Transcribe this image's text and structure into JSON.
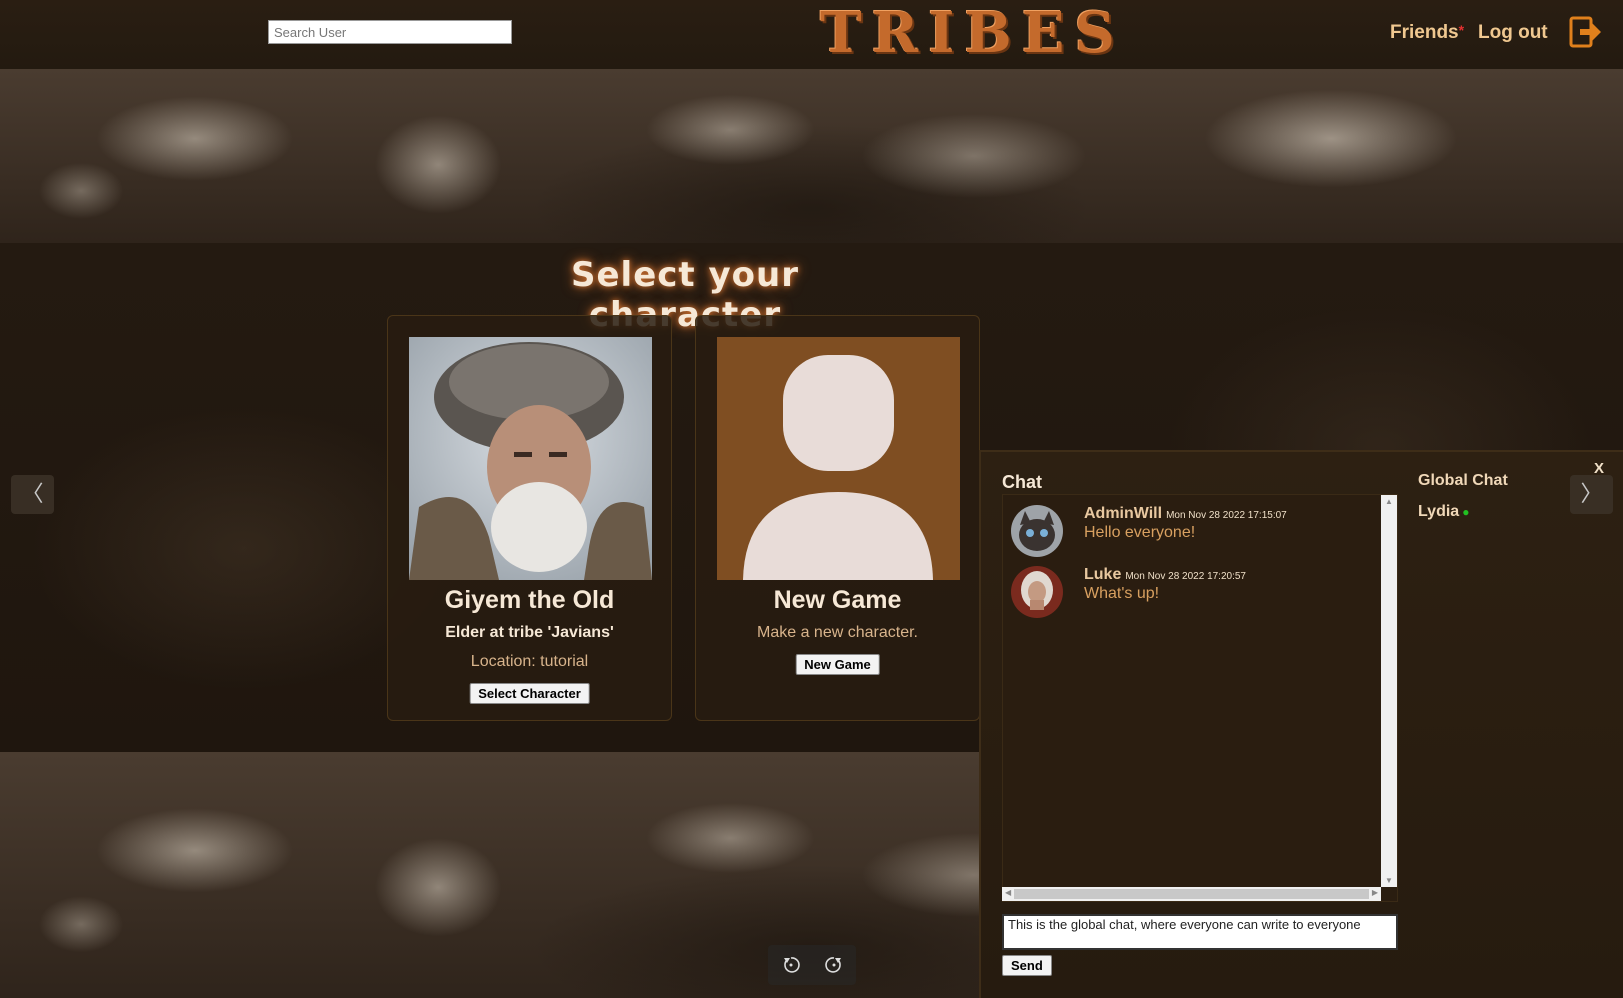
{
  "header": {
    "search_placeholder": "Search User",
    "logo": "TRIBES",
    "friends_label": "Friends",
    "friends_indicator": "*",
    "logout_label": "Log out"
  },
  "main": {
    "title": "Select your character",
    "characters": [
      {
        "name": "Giyem the Old",
        "role": "Elder at tribe 'Javians'",
        "location": "Location: tutorial",
        "button": "Select Character"
      },
      {
        "name": "New Game",
        "description": "Make a new character.",
        "button": "New Game"
      }
    ],
    "prev_arrow": "〈",
    "next_arrow": "〉"
  },
  "chat": {
    "title": "Chat",
    "close_label": "X",
    "messages": [
      {
        "author": "AdminWill",
        "timestamp": "Mon Nov 28 2022 17:15:07",
        "text": "Hello everyone!"
      },
      {
        "author": "Luke",
        "timestamp": "Mon Nov 28 2022 17:20:57",
        "text": "What's up!"
      }
    ],
    "input_value": "This is the global chat, where everyone can write to everyone",
    "send_label": "Send",
    "rooms": [
      {
        "label": "Global Chat"
      },
      {
        "label": "Lydia",
        "online": true
      }
    ]
  },
  "colors": {
    "accent": "#c46a2c",
    "text_light": "#f6e8d6",
    "online": "#22c022"
  }
}
